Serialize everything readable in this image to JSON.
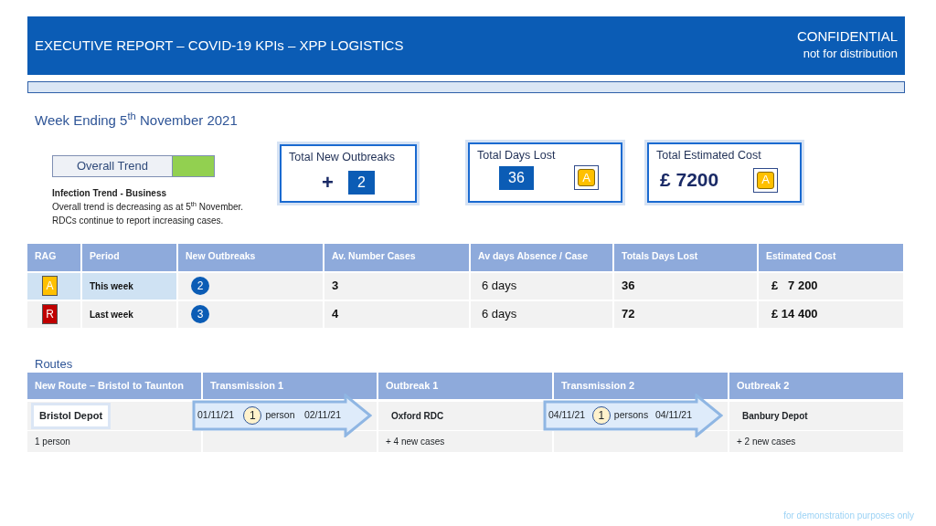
{
  "header": {
    "title": "EXECUTIVE REPORT – COVID-19 KPIs – XPP LOGISTICS",
    "classification": "CONFIDENTIAL",
    "note": "not for distribution"
  },
  "week_ending": "Week Ending 5$^{th}$ November 2021",
  "trend": {
    "label": "Overall Trend",
    "color": "#92d050"
  },
  "trend_summary": {
    "heading": "Infection Trend - Business",
    "lines": [
      "Overall trend is decreasing as at 5$^{th}$ November.",
      "RDCs continue to report increasing cases."
    ]
  },
  "kpis": [
    {
      "title": "Total New Outbreaks",
      "kind": "count",
      "prefix": "+",
      "value": "2"
    },
    {
      "title": "Total Days Lost",
      "kind": "count",
      "value": "36",
      "rag": {
        "label": "A",
        "color": "#ffc000"
      }
    },
    {
      "title": "Total Estimated Cost",
      "kind": "amount",
      "value": "£ 7200",
      "rag": {
        "label": "A",
        "color": "#ffc000"
      }
    }
  ],
  "table": {
    "columns": [
      "RAG",
      "Period",
      "New Outbreaks",
      "Av. Number Cases",
      "Av days Absence / Case",
      "Totals Days Lost",
      "Estimated Cost"
    ],
    "rows": [
      {
        "rag": "A",
        "color": "#ffc000",
        "period": "This week",
        "selected": true,
        "new_outbreaks": "2",
        "avg_cases": "3",
        "avg_days": "6 days",
        "days_lost": "36",
        "cost": "£   7 200"
      },
      {
        "rag": "R",
        "color": "#c00000",
        "period": "Last week",
        "selected": false,
        "new_outbreaks": "3",
        "avg_cases": "4",
        "avg_days": "6 days",
        "days_lost": "72",
        "cost": "£ 14 400"
      }
    ]
  },
  "routes": {
    "title": "Routes",
    "stages": [
      {
        "kind": "origin",
        "heading": "New Route – Bristol to Taunton",
        "name": "Bristol Depot",
        "note": "1 person"
      },
      {
        "kind": "transmission",
        "heading": "Transmission 1",
        "from": "01/11/21",
        "count": "1",
        "unit": "person",
        "to": "02/11/21"
      },
      {
        "kind": "outbreak",
        "heading": "Outbreak 1",
        "name": "Oxford RDC",
        "note": "+ 4 new cases"
      },
      {
        "kind": "transmission",
        "heading": "Transmission 2",
        "from": "04/11/21",
        "count": "1",
        "unit": "persons",
        "to": "04/11/21"
      },
      {
        "kind": "outbreak",
        "heading": "Outbreak 2",
        "name": "Banbury Depot",
        "note": "+ 2 new cases"
      }
    ]
  },
  "footer": "for demonstration purposes only"
}
